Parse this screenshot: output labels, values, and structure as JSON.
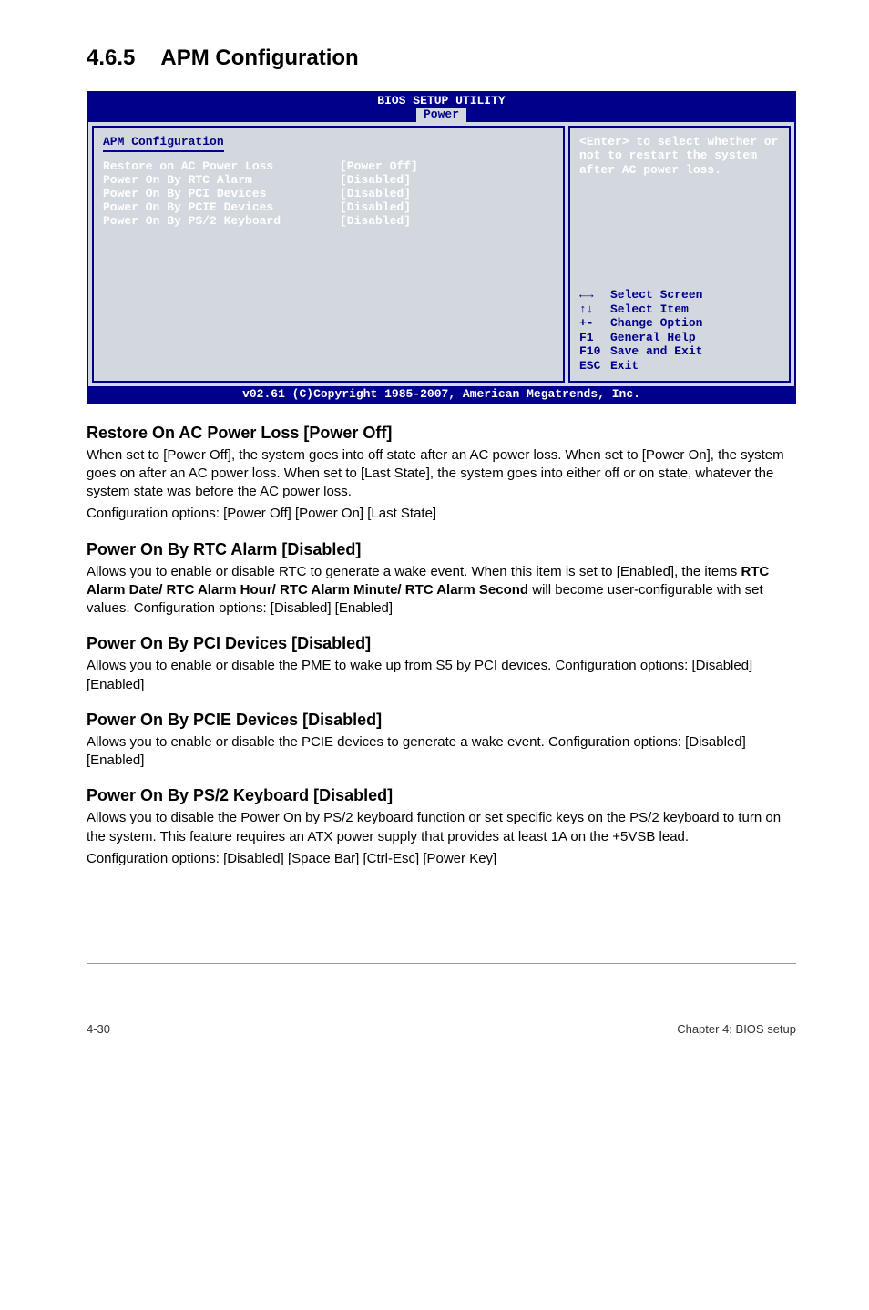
{
  "section": {
    "number": "4.6.5",
    "title": "APM Configuration"
  },
  "bios": {
    "header_title": "BIOS SETUP UTILITY",
    "header_tab": "Power",
    "left": {
      "heading": "APM Configuration",
      "rows": [
        {
          "label": "Restore on AC Power Loss",
          "value": "[Power Off]"
        },
        {
          "label": "Power On By RTC Alarm",
          "value": "[Disabled]"
        },
        {
          "label": "Power On By PCI Devices",
          "value": "[Disabled]"
        },
        {
          "label": "Power On By PCIE Devices",
          "value": "[Disabled]"
        },
        {
          "label": "Power On By PS/2 Keyboard",
          "value": "[Disabled]"
        }
      ]
    },
    "right": {
      "hint": "<Enter> to select whether or not to restart the system after AC power loss.",
      "nav": [
        {
          "icon": "←→",
          "label": "Select Screen"
        },
        {
          "icon": "↑↓",
          "label": "Select Item"
        },
        {
          "icon": "+-",
          "label": "Change Option"
        },
        {
          "icon": "F1",
          "label": "General Help"
        },
        {
          "icon": "F10",
          "label": "Save and Exit"
        },
        {
          "icon": "ESC",
          "label": "Exit"
        }
      ]
    },
    "footer": "v02.61 (C)Copyright 1985-2007, American Megatrends, Inc."
  },
  "subsections": [
    {
      "heading": "Restore On AC Power Loss [Power Off]",
      "paragraphs": [
        "When set to [Power Off], the system goes into off state after an AC power loss. When set to [Power On], the system goes on after an AC power loss. When set to [Last State], the system goes into either off or on state, whatever the system state was before the AC power loss.",
        "Configuration options: [Power Off] [Power On] [Last State]"
      ]
    },
    {
      "heading": "Power On By RTC Alarm [Disabled]",
      "paragraphs": [
        "Allows you to enable or disable RTC to generate a wake event. When this item is set to [Enabled], the items <b>RTC Alarm Date/ RTC Alarm Hour/ RTC Alarm Minute/ RTC Alarm Second</b> will become user-configurable with set values. Configuration options: [Disabled] [Enabled]"
      ]
    },
    {
      "heading": "Power On By PCI Devices [Disabled]",
      "paragraphs": [
        "Allows you to enable or disable the PME to wake up from S5 by PCI devices. Configuration options: [Disabled] [Enabled]"
      ]
    },
    {
      "heading": "Power On By PCIE Devices [Disabled]",
      "paragraphs": [
        "Allows you to enable or disable the PCIE devices to generate a wake event. Configuration options: [Disabled] [Enabled]"
      ]
    },
    {
      "heading": "Power On By PS/2 Keyboard [Disabled]",
      "paragraphs": [
        "Allows you to disable the Power On by PS/2 keyboard function or set specific keys on the PS/2 keyboard to turn on the system. This feature requires an ATX power supply that provides at least 1A on the +5VSB lead.",
        "Configuration options: [Disabled] [Space Bar] [Ctrl-Esc] [Power Key]"
      ]
    }
  ],
  "page_footer": {
    "left": "4-30",
    "right": "Chapter 4: BIOS setup"
  }
}
